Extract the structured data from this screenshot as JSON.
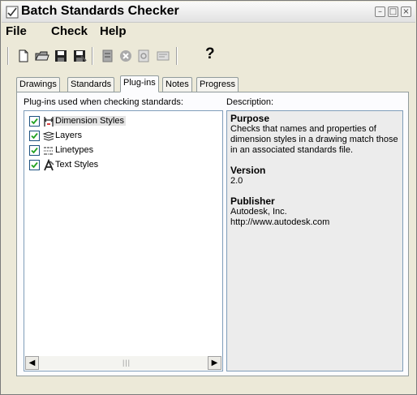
{
  "window": {
    "title": "Batch Standards Checker",
    "controls": [
      "minimize-icon",
      "maximize-icon",
      "close-icon"
    ]
  },
  "menu": [
    "File",
    "Check",
    "Help"
  ],
  "toolbar": {
    "buttons": [
      "new-icon",
      "open-icon",
      "save-icon",
      "save-as-icon",
      "start-check-icon",
      "stop-check-icon",
      "view-report-icon",
      "export-report-icon",
      "help-icon"
    ],
    "help_glyph": "?"
  },
  "tabs": [
    {
      "label": "Drawings",
      "active": false
    },
    {
      "label": "Standards",
      "active": false
    },
    {
      "label": "Plug-ins",
      "active": true
    },
    {
      "label": "Notes",
      "active": false
    },
    {
      "label": "Progress",
      "active": false
    }
  ],
  "plugins": {
    "heading": "Plug-ins used when checking standards:",
    "items": [
      {
        "label": "Dimension Styles",
        "checked": true,
        "selected": true,
        "icon": "dimension-styles-icon"
      },
      {
        "label": "Layers",
        "checked": true,
        "selected": false,
        "icon": "layers-icon"
      },
      {
        "label": "Linetypes",
        "checked": true,
        "selected": false,
        "icon": "linetypes-icon"
      },
      {
        "label": "Text Styles",
        "checked": true,
        "selected": false,
        "icon": "text-styles-icon"
      }
    ]
  },
  "description": {
    "heading": "Description:",
    "purpose_label": "Purpose",
    "purpose_text": "Checks that names and properties of dimension styles in a drawing match those in an associated standards file.",
    "version_label": "Version",
    "version_value": "2.0",
    "publisher_label": "Publisher",
    "publisher_name": "Autodesk, Inc.",
    "publisher_url": "http://www.autodesk.com"
  },
  "colors": {
    "window_bg": "#ece9d8",
    "panel_bg": "#fcfcfe",
    "list_border": "#7f9db9",
    "description_bg": "#ececec"
  }
}
